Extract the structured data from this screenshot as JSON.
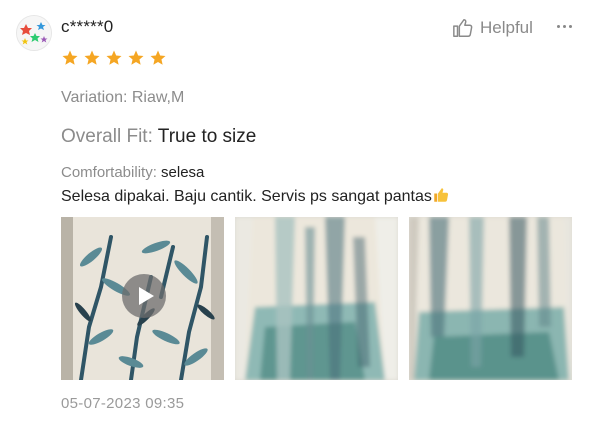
{
  "review": {
    "username": "c*****0",
    "rating": 5,
    "helpful_label": "Helpful",
    "variation": "Variation: Riaw,M",
    "fit_label": "Overall Fit:",
    "fit_value": "True to size",
    "comfort_label": "Comfortability:",
    "comfort_value": "selesa",
    "text": "Selesa dipakai. Baju cantik. Servis ps sangat pantas",
    "date": "05-07-2023 09:35",
    "media": [
      {
        "type": "video",
        "icon": "play-icon"
      },
      {
        "type": "image"
      },
      {
        "type": "image"
      }
    ]
  },
  "colors": {
    "star": "#f5a623",
    "muted_text": "#8c8c8c",
    "thumbs_emoji": "#f7c23b"
  },
  "icons": [
    "avatar",
    "thumbs-up-icon",
    "more-icon",
    "star-icon",
    "play-icon",
    "thumbs-up-emoji"
  ]
}
